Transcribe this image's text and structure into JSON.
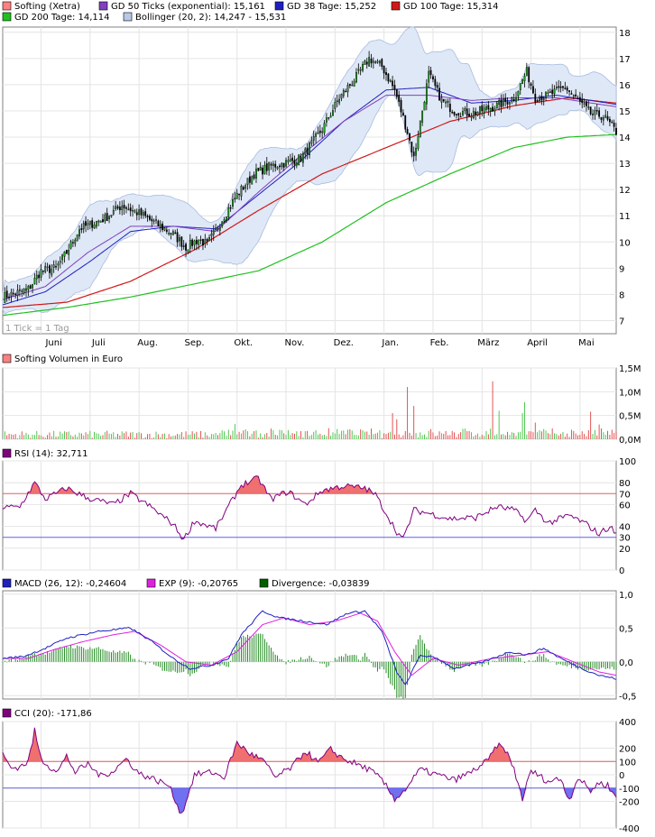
{
  "chart_data": [
    {
      "type": "candlestick",
      "title": "",
      "legend": [
        {
          "label": "Softing (Xetra)",
          "color": "#ff8080"
        },
        {
          "label": "GD 50 Ticks (exponential): 15,161",
          "color": "#8040c0"
        },
        {
          "label": "GD 38 Tage: 15,252",
          "color": "#2020c0"
        },
        {
          "label": "GD 100 Tage: 15,314",
          "color": "#d01818"
        },
        {
          "label": "GD 200 Tage: 14,114",
          "color": "#20c020"
        },
        {
          "label": "Bollinger (20, 2): 14,247 - 15,531",
          "color": "#b8c8e8"
        }
      ],
      "y_ticks": [
        "18",
        "17",
        "16",
        "15",
        "14",
        "13",
        "12",
        "11",
        "10",
        "9",
        "8",
        "7"
      ],
      "ylim": [
        6.5,
        18.2
      ],
      "x_ticks": [
        "Juni",
        "Juli",
        "Aug.",
        "Sep.",
        "Okt.",
        "Nov.",
        "Dez.",
        "Jan.",
        "Feb.",
        "März",
        "April",
        "Mai"
      ],
      "note": "1 Tick = 1 Tag",
      "grid": true,
      "close_keypoints": [
        [
          0,
          7.9
        ],
        [
          12,
          8.2
        ],
        [
          18,
          8.9
        ],
        [
          25,
          9.0
        ],
        [
          30,
          9.6
        ],
        [
          36,
          10.5
        ],
        [
          48,
          10.9
        ],
        [
          56,
          11.4
        ],
        [
          66,
          11.0
        ],
        [
          72,
          10.7
        ],
        [
          80,
          10.3
        ],
        [
          86,
          9.8
        ],
        [
          92,
          10.1
        ],
        [
          96,
          9.9
        ],
        [
          104,
          11.0
        ],
        [
          110,
          11.8
        ],
        [
          118,
          12.6
        ],
        [
          126,
          12.9
        ],
        [
          132,
          13.0
        ],
        [
          140,
          13.2
        ],
        [
          150,
          14.3
        ],
        [
          158,
          15.5
        ],
        [
          166,
          16.3
        ],
        [
          172,
          17.0
        ],
        [
          178,
          16.7
        ],
        [
          184,
          15.8
        ],
        [
          190,
          14.2
        ],
        [
          193,
          13.2
        ],
        [
          200,
          16.4
        ],
        [
          206,
          15.4
        ],
        [
          212,
          15.0
        ],
        [
          220,
          14.9
        ],
        [
          232,
          15.2
        ],
        [
          240,
          15.5
        ],
        [
          246,
          16.5
        ],
        [
          250,
          15.5
        ],
        [
          256,
          15.6
        ],
        [
          264,
          15.9
        ],
        [
          270,
          15.4
        ],
        [
          276,
          14.9
        ],
        [
          282,
          14.8
        ],
        [
          288,
          14.2
        ]
      ],
      "sma100_keypoints": [
        [
          0,
          7.5
        ],
        [
          30,
          7.7
        ],
        [
          60,
          8.5
        ],
        [
          90,
          9.7
        ],
        [
          120,
          11.2
        ],
        [
          150,
          12.6
        ],
        [
          180,
          13.6
        ],
        [
          210,
          14.6
        ],
        [
          240,
          15.2
        ],
        [
          265,
          15.5
        ],
        [
          288,
          15.3
        ]
      ],
      "sma200_keypoints": [
        [
          0,
          7.2
        ],
        [
          30,
          7.5
        ],
        [
          60,
          7.9
        ],
        [
          90,
          8.4
        ],
        [
          120,
          8.9
        ],
        [
          150,
          10.0
        ],
        [
          180,
          11.5
        ],
        [
          210,
          12.6
        ],
        [
          240,
          13.6
        ],
        [
          265,
          14.0
        ],
        [
          288,
          14.1
        ]
      ],
      "sma38_keypoints": [
        [
          0,
          7.6
        ],
        [
          20,
          8.1
        ],
        [
          40,
          9.2
        ],
        [
          60,
          10.4
        ],
        [
          80,
          10.6
        ],
        [
          100,
          10.5
        ],
        [
          120,
          11.8
        ],
        [
          140,
          13.1
        ],
        [
          160,
          14.6
        ],
        [
          180,
          15.8
        ],
        [
          200,
          15.9
        ],
        [
          220,
          15.3
        ],
        [
          240,
          15.4
        ],
        [
          260,
          15.6
        ],
        [
          288,
          15.25
        ]
      ],
      "ema50_keypoints": [
        [
          0,
          7.8
        ],
        [
          20,
          8.3
        ],
        [
          40,
          9.6
        ],
        [
          60,
          10.6
        ],
        [
          80,
          10.6
        ],
        [
          100,
          10.4
        ],
        [
          120,
          11.9
        ],
        [
          140,
          13.3
        ],
        [
          160,
          14.6
        ],
        [
          180,
          15.6
        ],
        [
          200,
          15.6
        ],
        [
          220,
          15.4
        ],
        [
          240,
          15.5
        ],
        [
          260,
          15.5
        ],
        [
          288,
          15.16
        ]
      ]
    },
    {
      "type": "bar",
      "legend": [
        {
          "label": "Softing Volumen in Euro",
          "color": "#ff8080"
        }
      ],
      "y_ticks": [
        "1,5M",
        "1,0M",
        "0,5M",
        "0,0M"
      ],
      "ylim": [
        0,
        1.5
      ],
      "grid": true,
      "spikes": [
        [
          109,
          0.32
        ],
        [
          183,
          0.55
        ],
        [
          185,
          0.42
        ],
        [
          190,
          1.1
        ],
        [
          193,
          0.7
        ],
        [
          230,
          1.22
        ],
        [
          233,
          0.6
        ],
        [
          244,
          0.55
        ],
        [
          245,
          0.78
        ],
        [
          250,
          0.35
        ],
        [
          276,
          0.58
        ],
        [
          280,
          0.31
        ]
      ]
    },
    {
      "type": "line",
      "legend": [
        {
          "label": "RSI (14): 32,711",
          "color": "#800080"
        }
      ],
      "y_ticks": [
        "100",
        "80",
        "60",
        "40",
        "20",
        "0"
      ],
      "ylim": [
        0,
        100
      ],
      "reference_lines": [
        {
          "label": "70",
          "value": 70,
          "color": "#e06060"
        },
        {
          "label": "30",
          "value": 30,
          "color": "#6060e0"
        }
      ],
      "keypoints": [
        [
          0,
          57
        ],
        [
          8,
          58
        ],
        [
          15,
          80
        ],
        [
          20,
          65
        ],
        [
          30,
          75
        ],
        [
          40,
          66
        ],
        [
          52,
          60
        ],
        [
          60,
          70
        ],
        [
          70,
          57
        ],
        [
          80,
          42
        ],
        [
          85,
          28
        ],
        [
          90,
          45
        ],
        [
          100,
          38
        ],
        [
          106,
          58
        ],
        [
          112,
          78
        ],
        [
          120,
          84
        ],
        [
          126,
          65
        ],
        [
          134,
          72
        ],
        [
          142,
          60
        ],
        [
          150,
          73
        ],
        [
          160,
          77
        ],
        [
          170,
          75
        ],
        [
          175,
          69
        ],
        [
          180,
          52
        ],
        [
          185,
          35
        ],
        [
          188,
          28
        ],
        [
          193,
          55
        ],
        [
          200,
          52
        ],
        [
          210,
          47
        ],
        [
          222,
          48
        ],
        [
          232,
          58
        ],
        [
          240,
          55
        ],
        [
          246,
          45
        ],
        [
          250,
          55
        ],
        [
          256,
          43
        ],
        [
          266,
          50
        ],
        [
          274,
          42
        ],
        [
          280,
          33
        ],
        [
          285,
          40
        ],
        [
          288,
          32.7
        ]
      ]
    },
    {
      "type": "line",
      "legend": [
        {
          "label": "MACD (26, 12): -0,24604",
          "color": "#2020c0"
        },
        {
          "label": "EXP (9): -0,20765",
          "color": "#e020e0"
        },
        {
          "label": "Divergence: -0,03839",
          "color": "#006000"
        }
      ],
      "y_ticks": [
        "1,0",
        "0,5",
        "0,0",
        "-0,5"
      ],
      "ylim": [
        -0.55,
        1.05
      ],
      "macd_keypoints": [
        [
          0,
          0.05
        ],
        [
          10,
          0.08
        ],
        [
          20,
          0.2
        ],
        [
          30,
          0.35
        ],
        [
          45,
          0.45
        ],
        [
          60,
          0.5
        ],
        [
          70,
          0.3
        ],
        [
          80,
          0.05
        ],
        [
          88,
          -0.1
        ],
        [
          98,
          -0.05
        ],
        [
          106,
          0.05
        ],
        [
          112,
          0.4
        ],
        [
          122,
          0.75
        ],
        [
          130,
          0.65
        ],
        [
          142,
          0.6
        ],
        [
          152,
          0.55
        ],
        [
          162,
          0.72
        ],
        [
          170,
          0.75
        ],
        [
          178,
          0.45
        ],
        [
          185,
          -0.15
        ],
        [
          189,
          -0.35
        ],
        [
          196,
          0.1
        ],
        [
          204,
          0.05
        ],
        [
          212,
          -0.1
        ],
        [
          226,
          0.0
        ],
        [
          238,
          0.15
        ],
        [
          246,
          0.1
        ],
        [
          254,
          0.2
        ],
        [
          262,
          0.05
        ],
        [
          272,
          -0.1
        ],
        [
          280,
          -0.2
        ],
        [
          288,
          -0.25
        ]
      ],
      "exp_keypoints": [
        [
          0,
          0.05
        ],
        [
          12,
          0.05
        ],
        [
          24,
          0.18
        ],
        [
          38,
          0.3
        ],
        [
          52,
          0.4
        ],
        [
          62,
          0.45
        ],
        [
          74,
          0.25
        ],
        [
          86,
          0.0
        ],
        [
          98,
          -0.05
        ],
        [
          110,
          0.15
        ],
        [
          122,
          0.55
        ],
        [
          132,
          0.65
        ],
        [
          144,
          0.55
        ],
        [
          156,
          0.6
        ],
        [
          168,
          0.72
        ],
        [
          176,
          0.6
        ],
        [
          184,
          0.15
        ],
        [
          192,
          -0.2
        ],
        [
          202,
          0.05
        ],
        [
          214,
          -0.05
        ],
        [
          230,
          0.05
        ],
        [
          244,
          0.1
        ],
        [
          256,
          0.15
        ],
        [
          268,
          0.0
        ],
        [
          280,
          -0.15
        ],
        [
          288,
          -0.2
        ]
      ]
    },
    {
      "type": "area",
      "legend": [
        {
          "label": "CCI (20): -171,86",
          "color": "#800080"
        }
      ],
      "y_ticks": [
        "400",
        "200",
        "100",
        "0",
        "-100",
        "-200",
        "-400"
      ],
      "ylim": [
        -400,
        400
      ],
      "reference_lines": [
        {
          "label": "100",
          "value": 100,
          "color": "#e06060"
        },
        {
          "label": "-100",
          "value": -100,
          "color": "#6060e0"
        }
      ],
      "keypoints": [
        [
          0,
          150
        ],
        [
          4,
          50
        ],
        [
          8,
          60
        ],
        [
          12,
          100
        ],
        [
          15,
          330
        ],
        [
          18,
          120
        ],
        [
          22,
          60
        ],
        [
          26,
          30
        ],
        [
          30,
          140
        ],
        [
          34,
          20
        ],
        [
          40,
          80
        ],
        [
          46,
          -10
        ],
        [
          52,
          30
        ],
        [
          58,
          120
        ],
        [
          64,
          10
        ],
        [
          72,
          -40
        ],
        [
          78,
          -80
        ],
        [
          84,
          -300
        ],
        [
          90,
          0
        ],
        [
          98,
          20
        ],
        [
          104,
          -20
        ],
        [
          110,
          240
        ],
        [
          116,
          160
        ],
        [
          122,
          110
        ],
        [
          128,
          -20
        ],
        [
          136,
          60
        ],
        [
          142,
          180
        ],
        [
          148,
          90
        ],
        [
          154,
          190
        ],
        [
          160,
          120
        ],
        [
          166,
          80
        ],
        [
          172,
          40
        ],
        [
          178,
          -40
        ],
        [
          184,
          -180
        ],
        [
          188,
          -130
        ],
        [
          196,
          40
        ],
        [
          204,
          0
        ],
        [
          212,
          -40
        ],
        [
          220,
          20
        ],
        [
          228,
          110
        ],
        [
          232,
          220
        ],
        [
          236,
          190
        ],
        [
          240,
          40
        ],
        [
          244,
          -180
        ],
        [
          248,
          30
        ],
        [
          256,
          -50
        ],
        [
          262,
          -30
        ],
        [
          266,
          -190
        ],
        [
          270,
          -20
        ],
        [
          276,
          -120
        ],
        [
          280,
          -60
        ],
        [
          284,
          -80
        ],
        [
          288,
          -172
        ]
      ]
    }
  ]
}
